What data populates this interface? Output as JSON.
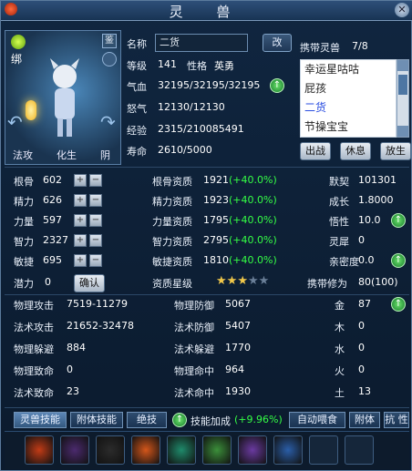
{
  "window": {
    "title": "灵 兽",
    "close_icon": "✕"
  },
  "portrait": {
    "bind_label": "绑",
    "identify_label": "鉴",
    "attack_type": "法攻",
    "transform": "化生",
    "alignment": "阴"
  },
  "info": {
    "name_label": "名称",
    "name_value": "二货",
    "rename_button": "改",
    "level_label": "等级",
    "level_value": "141",
    "personality_label": "性格",
    "personality_value": "英勇",
    "hp_label": "气血",
    "hp_value": "32195/32195/32195",
    "rage_label": "怒气",
    "rage_value": "12130/12130",
    "exp_label": "经验",
    "exp_value": "2315/210085491",
    "life_label": "寿命",
    "life_value": "2610/5000"
  },
  "pets": {
    "header_label": "携带灵兽",
    "count": "7/8",
    "items": [
      "幸运星咕咕",
      "屁孩",
      "二货",
      "节操宝宝"
    ],
    "selected_index": 2,
    "buttons": {
      "battle": "出战",
      "rest": "休息",
      "release": "放生"
    }
  },
  "attributes": {
    "rows": [
      {
        "label": "根骨",
        "value": "602",
        "aptitude_label": "根骨资质",
        "aptitude_value": "1921",
        "bonus": "(+40.0%)",
        "right_label": "默契",
        "right_value": "101301"
      },
      {
        "label": "精力",
        "value": "626",
        "aptitude_label": "精力资质",
        "aptitude_value": "1923",
        "bonus": "(+40.0%)",
        "right_label": "成长",
        "right_value": "1.8000"
      },
      {
        "label": "力量",
        "value": "597",
        "aptitude_label": "力量资质",
        "aptitude_value": "1795",
        "bonus": "(+40.0%)",
        "right_label": "悟性",
        "right_value": "10.0"
      },
      {
        "label": "智力",
        "value": "2327",
        "aptitude_label": "智力资质",
        "aptitude_value": "2795",
        "bonus": "(+40.0%)",
        "right_label": "灵犀",
        "right_value": "0"
      },
      {
        "label": "敏捷",
        "value": "695",
        "aptitude_label": "敏捷资质",
        "aptitude_value": "1810",
        "bonus": "(+40.0%)",
        "right_label": "亲密度",
        "right_value": "0.0"
      }
    ],
    "potential_label": "潜力",
    "potential_value": "0",
    "confirm_button": "确认",
    "star_label": "资质星级",
    "star_rating": 3,
    "star_max": 5,
    "cultivation_label": "携带修为",
    "cultivation_value": "80(100)"
  },
  "combat": {
    "rows": [
      {
        "label": "物理攻击",
        "value": "7519-11279",
        "label2": "物理防御",
        "value2": "5067",
        "el_label": "金",
        "el_value": "87"
      },
      {
        "label": "法术攻击",
        "value": "21652-32478",
        "label2": "法术防御",
        "value2": "5407",
        "el_label": "木",
        "el_value": "0"
      },
      {
        "label": "物理躲避",
        "value": "884",
        "label2": "法术躲避",
        "value2": "1770",
        "el_label": "水",
        "el_value": "0"
      },
      {
        "label": "物理致命",
        "value": "0",
        "label2": "物理命中",
        "value2": "964",
        "el_label": "火",
        "el_value": "0"
      },
      {
        "label": "法术致命",
        "value": "23",
        "label2": "法术命中",
        "value2": "1930",
        "el_label": "土",
        "el_value": "13"
      }
    ]
  },
  "tabs": {
    "items": [
      "灵兽技能",
      "附体技能",
      "绝技"
    ],
    "skill_bonus_label": "技能加成",
    "skill_bonus_value": "(+9.96%)",
    "auto_feed": "自动喂食",
    "possess": "附体",
    "resist": "抗 性"
  },
  "skills": [
    "fire-slash-icon",
    "shadow-beast-icon",
    "black-cat-icon",
    "flame-burst-icon",
    "ice-shard-icon",
    "wind-blade-icon",
    "purple-claw-icon",
    "blue-orb-icon"
  ],
  "colors": {
    "accent_green": "#35ff45",
    "panel_bg": "#102640",
    "highlight_blue": "#2a4de0"
  }
}
